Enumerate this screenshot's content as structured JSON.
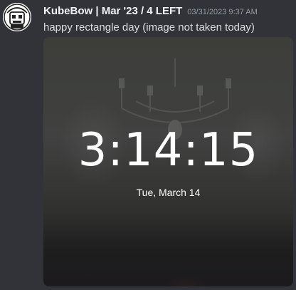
{
  "message": {
    "username": "KubeBow | Mar '23 / 4 LEFT",
    "timestamp": "03/31/2023 9:37 AM",
    "text": "happy rectangle day (image not taken today)",
    "avatar": {
      "icon": "robot-avatar-icon"
    }
  },
  "attachment": {
    "clock_time": "3:14:15",
    "clock_date": "Tue, March 14"
  },
  "colors": {
    "background": "#313338",
    "username": "#f2f3f5",
    "timestamp": "#949ba4",
    "message_text": "#dbdee1"
  }
}
